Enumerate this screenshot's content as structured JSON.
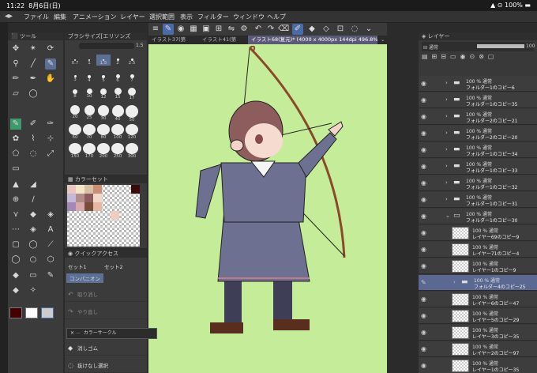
{
  "status": {
    "time": "11:22",
    "date": "8月6日(日)",
    "battery": "100%"
  },
  "menu": [
    "ファイル",
    "編集",
    "アニメーション",
    "レイヤー",
    "選択範囲",
    "表示",
    "フィルター",
    "ウィンドウ",
    "ヘルプ"
  ],
  "tabs": [
    "イラスト37(第",
    "イラスト41(第",
    "イラスト68(复元)* (4000 x 4000px 144dpi 496.8%)"
  ],
  "tool_panel": {
    "title": "ツール"
  },
  "brush_panel": {
    "title": "ブラシサイズ[エリソンズ",
    "value": "1.5",
    "sizes": [
      "0.7",
      "1",
      "1.5",
      "2",
      "2.5",
      "3",
      "4",
      "5",
      "6",
      "7",
      "8",
      "10",
      "12",
      "15",
      "17",
      "20",
      "25",
      "30",
      "40",
      "50",
      "60",
      "70",
      "80",
      "100",
      "120",
      "150",
      "170",
      "200",
      "250",
      "300"
    ]
  },
  "color_set": {
    "title": "カラーセット"
  },
  "quick_access": {
    "title": "クイックアクセス",
    "tabs": [
      "セット1",
      "セット2",
      "コンパニオン"
    ],
    "items": [
      {
        "label": "取り消し",
        "icon": "undo-icon",
        "enabled": false
      },
      {
        "label": "やり直し",
        "icon": "redo-icon",
        "enabled": false
      },
      {
        "label": "カラーサークル",
        "icon": "pen-icon",
        "enabled": true
      },
      {
        "label": "消しゴム",
        "icon": "eraser-icon",
        "enabled": true
      },
      {
        "label": "抜けなし選択",
        "icon": "select-icon",
        "enabled": true
      }
    ]
  },
  "popup": {
    "label": "カラーサークル"
  },
  "layer_panel": {
    "title": "レイヤー",
    "blend_mode": "通常",
    "opacity": "100",
    "layers": [
      {
        "line1": "100 % 通常",
        "line2": "フォルダー1のコピー6",
        "type": "folder",
        "indent": 0
      },
      {
        "line1": "100 % 通常",
        "line2": "フォルダー1のコピー35",
        "type": "folder",
        "indent": 0
      },
      {
        "line1": "100 % 通常",
        "line2": "フォルダー2のコピー21",
        "type": "folder",
        "indent": 0
      },
      {
        "line1": "100 % 通常",
        "line2": "フォルダー2のコピー20",
        "type": "folder",
        "indent": 0
      },
      {
        "line1": "100 % 通常",
        "line2": "フォルダー1のコピー34",
        "type": "folder",
        "indent": 0
      },
      {
        "line1": "100 % 通常",
        "line2": "フォルダー1のコピー33",
        "type": "folder",
        "indent": 0
      },
      {
        "line1": "100 % 通常",
        "line2": "フォルダー1のコピー32",
        "type": "folder",
        "indent": 0
      },
      {
        "line1": "100 % 通常",
        "line2": "フォルダー1のコピー31",
        "type": "folder",
        "indent": 0
      },
      {
        "line1": "100 % 通常",
        "line2": "フォルダー1のコピー30",
        "type": "folder-open",
        "indent": 0
      },
      {
        "line1": "100 % 通常",
        "line2": "レイヤー69のコピー9",
        "type": "layer",
        "indent": 1
      },
      {
        "line1": "100 % 通常",
        "line2": "レイヤー71のコピー4",
        "type": "layer",
        "indent": 1
      },
      {
        "line1": "100 % 通常",
        "line2": "レイヤー1のコピー9",
        "type": "layer",
        "indent": 1
      },
      {
        "line1": "100 % 通常",
        "line2": "フォルダー4のコピー25",
        "type": "folder",
        "indent": 1,
        "selected": true
      },
      {
        "line1": "100 % 通常",
        "line2": "レイヤー6のコピー47",
        "type": "layer",
        "indent": 1
      },
      {
        "line1": "100 % 通常",
        "line2": "レイヤー5のコピー29",
        "type": "layer",
        "indent": 1
      },
      {
        "line1": "100 % 通常",
        "line2": "レイヤー3のコピー35",
        "type": "layer",
        "indent": 1
      },
      {
        "line1": "100 % 通常",
        "line2": "レイヤー2のコピー97",
        "type": "layer",
        "indent": 1
      },
      {
        "line1": "100 % 通常",
        "line2": "レイヤー1のコピー35",
        "type": "layer",
        "indent": 1
      }
    ]
  },
  "colors": {
    "canvas_bg": "#c5ec98",
    "selection": "#5b6892",
    "accent": "#4a6aa8"
  }
}
